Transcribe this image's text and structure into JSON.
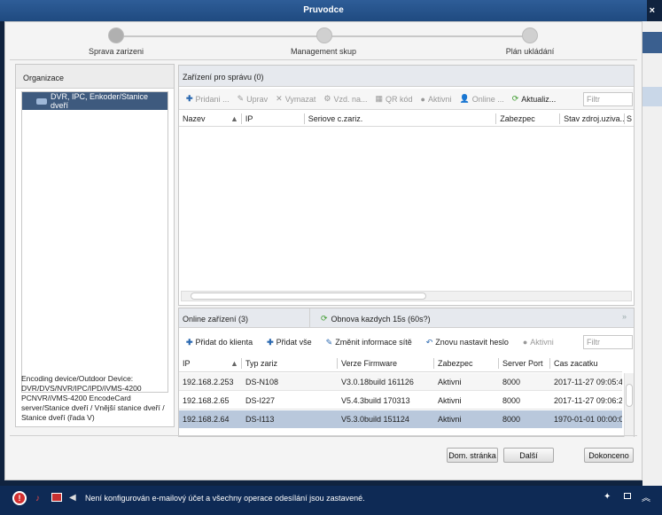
{
  "window": {
    "title": "Pruvodce"
  },
  "steps": [
    {
      "label": "Sprava zarizeni",
      "active": true
    },
    {
      "label": "Management skup",
      "active": false
    },
    {
      "label": "Plán ukládání",
      "active": false
    }
  ],
  "org": {
    "header": "Organizace",
    "selected_item": "DVR, IPC, Enkoder/Stanice dveří",
    "description": "Encoding device/Outdoor Device: DVR/DVS/NVR/IPC/IPD/iVMS-4200 PCNVR/iVMS-4200 EncodeCard server/Stanice dveří / Vnější stanice dveří / Stanice dveří (řada V)"
  },
  "managed": {
    "header": "Zařízení pro správu (0)",
    "toolbar": {
      "add": "Pridani ...",
      "edit": "Uprav",
      "delete": "Vymazat",
      "remote": "Vzd. na...",
      "qr": "QR kód",
      "active": "Aktivni",
      "online": "Online ...",
      "refresh": "Aktualiz..."
    },
    "filter_placeholder": "Filtr",
    "columns": [
      "Nazev",
      "IP",
      "Seriove c.zariz.",
      "Zabezpec",
      "Stav zdroj.uziva...",
      "S"
    ]
  },
  "online": {
    "tab_label": "Online zařízení (3)",
    "refresh_label": "Obnova kazdych 15s (60s?)",
    "toolbar": {
      "add_client": "Přidat do klienta",
      "add_all": "Přidat vše",
      "edit_net": "Změnit informace sítě",
      "reset_pwd": "Znovu nastavit heslo",
      "active": "Aktivni"
    },
    "filter_placeholder": "Filtr",
    "columns": [
      "IP",
      "Typ zariz",
      "Verze Firmware",
      "Zabezpec",
      "Server Port",
      "Cas zacatku"
    ],
    "rows": [
      [
        "192.168.2.253",
        "DS-N108",
        "V3.0.18build 161126",
        "Aktivni",
        "8000",
        "2017-11-27 09:05:4"
      ],
      [
        "192.168.2.65",
        "DS-I227",
        "V5.4.3build 170313",
        "Aktivni",
        "8000",
        "2017-11-27 09:06:2"
      ],
      [
        "192.168.2.64",
        "DS-I113",
        "V5.3.0build 151124",
        "Aktivni",
        "8000",
        "1970-01-01 00:00:0"
      ]
    ]
  },
  "buttons": {
    "home": "Dom. stránka",
    "next": "Další",
    "finish": "Dokonceno"
  },
  "status": {
    "message": "Není konfigurován e-mailový účet a všechny operace odesílání jsou zastavené."
  }
}
